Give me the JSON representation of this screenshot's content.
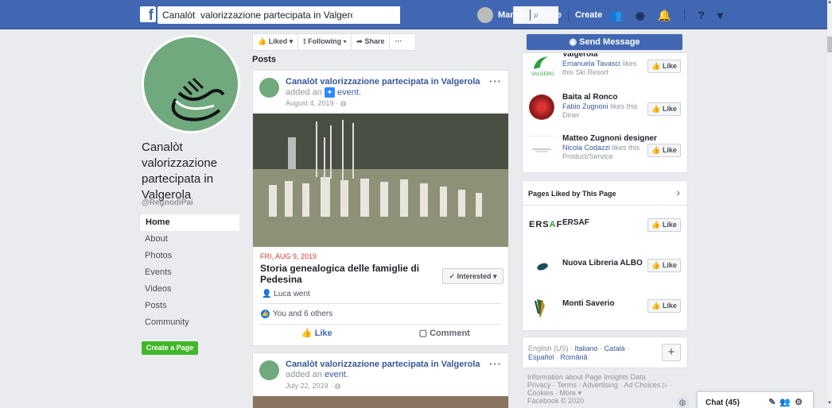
{
  "header": {
    "search_value": "Canalòt  valorizzazione partecipata in Valgerola",
    "user_name": "Marco",
    "home": "Home",
    "create": "Create"
  },
  "page": {
    "name": "Canalòt valorizzazione partecipata in Valgerola",
    "handle": "@RegnodiPai"
  },
  "nav": {
    "items": [
      "Home",
      "About",
      "Photos",
      "Events",
      "Videos",
      "Posts",
      "Community"
    ],
    "create_page": "Create a Page"
  },
  "actions": {
    "liked": "Liked ▾",
    "following": "Following ▾",
    "share": "Share",
    "more": "···"
  },
  "posts": {
    "title": "Posts",
    "post1": {
      "author": "Canalòt valorizzazione partecipata in Valgerola",
      "verb": "added an",
      "object": "event.",
      "date": "August 4, 2019 ·",
      "event_date": "FRI, AUG 9, 2019",
      "event_title": "Storia genealogica delle famiglie di Pedesina",
      "interested": "✓ Interested ▾",
      "went": "Luca went",
      "reactions": "You and 6 others",
      "like": "Like",
      "comment": "Comment"
    },
    "post2": {
      "author": "Canalòt valorizzazione partecipata in Valgerola",
      "verb": "added an",
      "object": "event.",
      "date": "July 22, 2019 ·"
    }
  },
  "right": {
    "send_message": "Send Message",
    "liked_items": [
      {
        "name": "Valgerola",
        "who": "Emanuela Tavasci",
        "likes": "likes this",
        "category": "Ski Resort",
        "like": "Like"
      },
      {
        "name": "Baita al Ronco",
        "who": "Fabio Zugnoni",
        "likes": "likes this",
        "category": "Diner",
        "like": "Like"
      },
      {
        "name": "Matteo Zugnoni designer",
        "who": "Nicola Codazzi",
        "likes": "likes this",
        "category": "Product/Service",
        "like": "Like"
      }
    ],
    "pages_liked_title": "Pages Liked by This Page",
    "pages_liked": [
      {
        "name": "ERSAF",
        "like": "Like"
      },
      {
        "name": "Nuova Libreria ALBO",
        "like": "Like"
      },
      {
        "name": "Monti Saverio",
        "like": "Like"
      }
    ],
    "languages": {
      "current": "English (US) ·",
      "l1": "Italiano",
      "l2": "Català",
      "l3": "Español",
      "l4": "Română"
    },
    "footer": {
      "line1": "Information about Page Insights Data",
      "line2": "Privacy · Terms · Advertising · Ad Choices ▷ ·",
      "line3": "Cookies · More ▾",
      "line4": "Facebook © 2020"
    }
  },
  "chat": {
    "label": "Chat (45)"
  }
}
